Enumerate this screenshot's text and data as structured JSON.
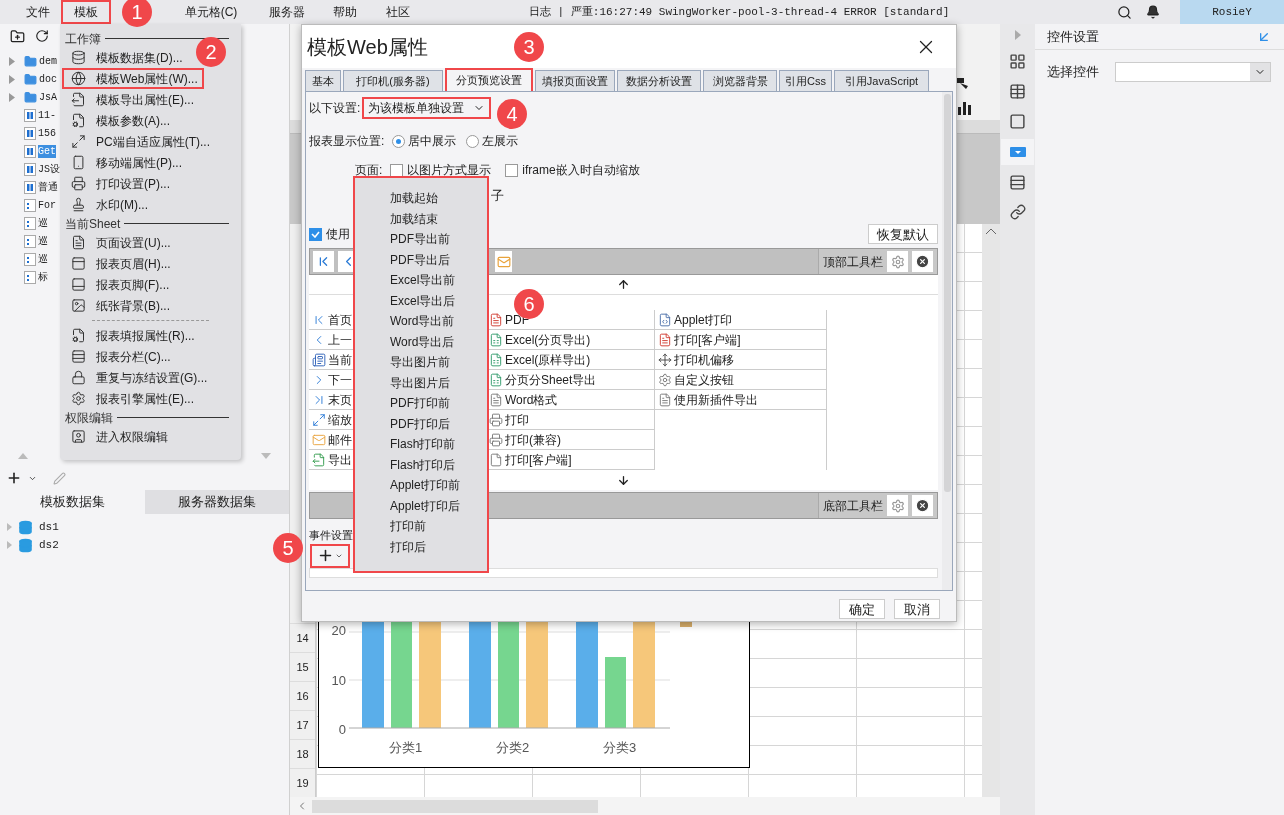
{
  "menubar": {
    "items": [
      {
        "label": "文件",
        "annotated": false
      },
      {
        "label": "模板",
        "annotated": true
      },
      {
        "label": "单元格(C)",
        "annotated": false
      },
      {
        "label": "服务器",
        "annotated": false
      },
      {
        "label": "帮助",
        "annotated": false
      },
      {
        "label": "社区",
        "annotated": false
      }
    ],
    "log": "日志 | 严重:16:27:49 SwingWorker-pool-3-thread-4 ERROR [standard]",
    "user": "RosieY"
  },
  "template_tree": {
    "items": [
      {
        "label": "dem",
        "kind": "folder",
        "selected": false
      },
      {
        "label": "doc",
        "kind": "folder",
        "selected": false
      },
      {
        "label": "JsA",
        "kind": "folder",
        "selected": false
      },
      {
        "label": "11-",
        "kind": "report",
        "selected": false
      },
      {
        "label": "156",
        "kind": "report",
        "selected": false
      },
      {
        "label": "Get",
        "kind": "report",
        "selected": true
      },
      {
        "label": "JS设",
        "kind": "report",
        "selected": false
      },
      {
        "label": "普通",
        "kind": "report",
        "selected": false
      },
      {
        "label": "For",
        "kind": "form",
        "selected": false
      },
      {
        "label": "巡",
        "kind": "form",
        "selected": false
      },
      {
        "label": "巡",
        "kind": "form",
        "selected": false
      },
      {
        "label": "巡",
        "kind": "form",
        "selected": false
      },
      {
        "label": "标",
        "kind": "form",
        "selected": false
      }
    ]
  },
  "dataset_panel": {
    "tabs": [
      {
        "label": "模板数据集",
        "selected": true
      },
      {
        "label": "服务器数据集",
        "selected": false
      }
    ],
    "items": [
      "ds1",
      "ds2"
    ]
  },
  "sheet": {
    "row_numbers": [
      "14",
      "15",
      "16",
      "17",
      "18",
      "19"
    ],
    "chart": {
      "yticks": [
        "20",
        "10",
        "0"
      ],
      "categories": [
        "分类1",
        "分类2",
        "分类3"
      ]
    }
  },
  "template_menu": {
    "sections": [
      {
        "title": "工作簿",
        "items": [
          {
            "label": "模板数据集(D)...",
            "annotated": false
          },
          {
            "label": "模板Web属性(W)...",
            "annotated": true
          },
          {
            "label": "模板导出属性(E)...",
            "annotated": false
          },
          {
            "label": "模板参数(A)...",
            "annotated": false
          },
          {
            "label": "PC端自适应属性(T)...",
            "annotated": false
          },
          {
            "label": "移动端属性(P)...",
            "annotated": false
          },
          {
            "label": "打印设置(P)...",
            "annotated": false
          },
          {
            "label": "水印(M)...",
            "annotated": false
          }
        ]
      },
      {
        "title": "当前Sheet",
        "items": [
          {
            "label": "页面设置(U)...",
            "annotated": false
          },
          {
            "label": "报表页眉(H)...",
            "annotated": false
          },
          {
            "label": "报表页脚(F)...",
            "annotated": false
          },
          {
            "label": "纸张背景(B)...",
            "annotated": false
          },
          {
            "kind": "separator"
          },
          {
            "label": "报表填报属性(R)...",
            "annotated": false
          },
          {
            "label": "报表分栏(C)...",
            "annotated": false
          },
          {
            "label": "重复与冻结设置(G)...",
            "annotated": false
          },
          {
            "label": "报表引擎属性(E)...",
            "annotated": false
          }
        ]
      },
      {
        "title": "权限编辑",
        "items": [
          {
            "label": "进入权限编辑",
            "annotated": false
          }
        ]
      }
    ]
  },
  "dialog": {
    "title": "模板Web属性",
    "tabs": [
      {
        "label": "基本",
        "selected": false,
        "annotated": false
      },
      {
        "label": "打印机(服务器)",
        "selected": false,
        "annotated": false
      },
      {
        "label": "分页预览设置",
        "selected": true,
        "annotated": true
      },
      {
        "label": "填报页面设置",
        "selected": false,
        "annotated": false
      },
      {
        "label": "数据分析设置",
        "selected": false,
        "annotated": false
      },
      {
        "label": "浏览器背景",
        "selected": false,
        "annotated": false
      },
      {
        "label": "引用Css",
        "selected": false,
        "annotated": false
      },
      {
        "label": "引用JavaScript",
        "selected": false,
        "annotated": false
      }
    ],
    "settings_label": "以下设置:",
    "settings_select": {
      "value": "为该模板单独设置",
      "annotated": true
    },
    "position_label": "报表显示位置:",
    "position_options": [
      {
        "label": "居中展示",
        "selected": true
      },
      {
        "label": "左展示",
        "selected": false
      }
    ],
    "page_label": "页面:",
    "page_options": [
      {
        "label": "以图片方式显示",
        "checked": false
      },
      {
        "label": "iframe嵌入时自动缩放",
        "checked": false
      }
    ],
    "partial_row_text": "子",
    "use_toggle": {
      "label": "使用",
      "checked": true
    },
    "restore_button": "恢复默认",
    "top_toolbar_label": "顶部工具栏",
    "bottom_toolbar_label": "底部工具栏",
    "button_columns": [
      [
        "首页",
        "上一",
        "当前",
        "下一",
        "末页",
        "缩放",
        "邮件",
        "导出"
      ],
      [
        "PDF",
        "Excel(分页导出)",
        "Excel(原样导出)",
        "分页分Sheet导出",
        "Word格式",
        "打印",
        "打印(兼容)",
        "打印[客户端]"
      ],
      [
        "Applet打印",
        "打印[客户端]",
        "打印机偏移",
        "自定义按钮",
        "使用新插件导出"
      ]
    ],
    "event_label": "事件设置",
    "add_button": {
      "annotated": true
    },
    "ok_button": "确定",
    "cancel_button": "取消"
  },
  "event_menu": {
    "items": [
      "加载起始",
      "加载结束",
      "PDF导出前",
      "PDF导出后",
      "Excel导出前",
      "Excel导出后",
      "Word导出前",
      "Word导出后",
      "导出图片前",
      "导出图片后",
      "PDF打印前",
      "PDF打印后",
      "Flash打印前",
      "Flash打印后",
      "Applet打印前",
      "Applet打印后",
      "打印前",
      "打印后"
    ]
  },
  "callouts": [
    "1",
    "2",
    "3",
    "4",
    "5",
    "6"
  ],
  "right_panel": {
    "title": "控件设置",
    "select_label": "选择控件"
  }
}
